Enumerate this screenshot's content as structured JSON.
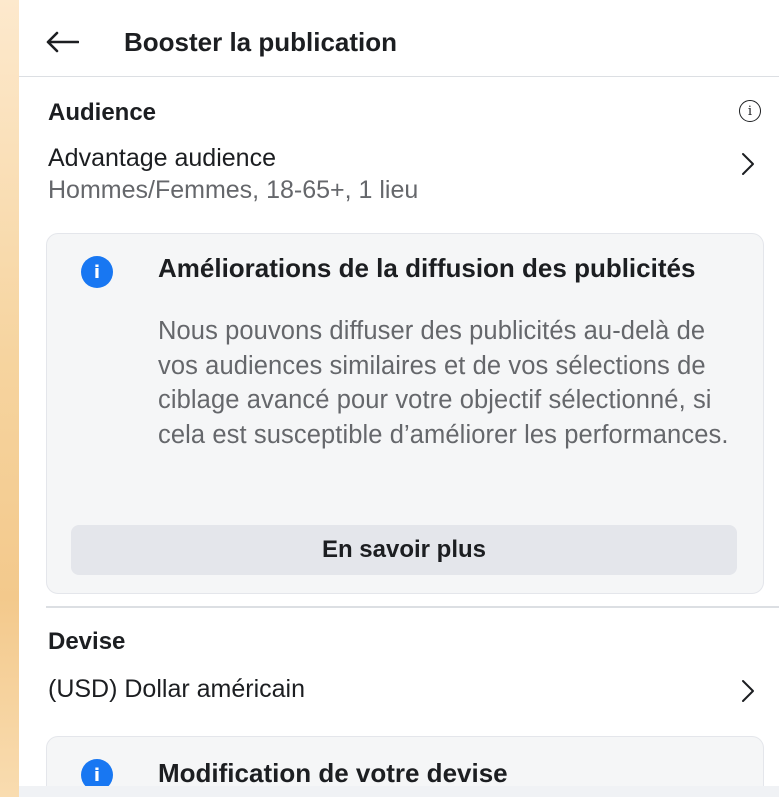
{
  "header": {
    "back_icon": "arrow-left-icon",
    "title": "Booster la publication"
  },
  "audience": {
    "heading": "Audience",
    "info_icon": "info-outline-icon",
    "info_glyph": "i",
    "row": {
      "title": "Advantage audience",
      "subtitle": "Hommes/Femmes, 18-65+, 1 lieu",
      "chevron_icon": "chevron-right-icon"
    },
    "card": {
      "icon": "info-filled-icon",
      "icon_glyph": "i",
      "title": "Améliorations de la diffusion des publicités",
      "body": "Nous pouvons diffuser des publicités au-delà de vos audiences similaires et de vos sélections de ciblage avancé pour votre objectif sélectionné, si cela est susceptible d’améliorer les performances.",
      "button_label": "En savoir plus"
    }
  },
  "currency": {
    "heading": "Devise",
    "row": {
      "title": "(USD) Dollar américain",
      "chevron_icon": "chevron-right-icon"
    },
    "card": {
      "icon": "info-filled-icon",
      "icon_glyph": "i",
      "title": "Modification de votre devise"
    }
  },
  "colors": {
    "accent": "#1877f2",
    "text_primary": "#1c1e21",
    "text_secondary": "#65676b",
    "card_bg": "#f5f6f7",
    "button_bg": "#e4e6eb"
  }
}
